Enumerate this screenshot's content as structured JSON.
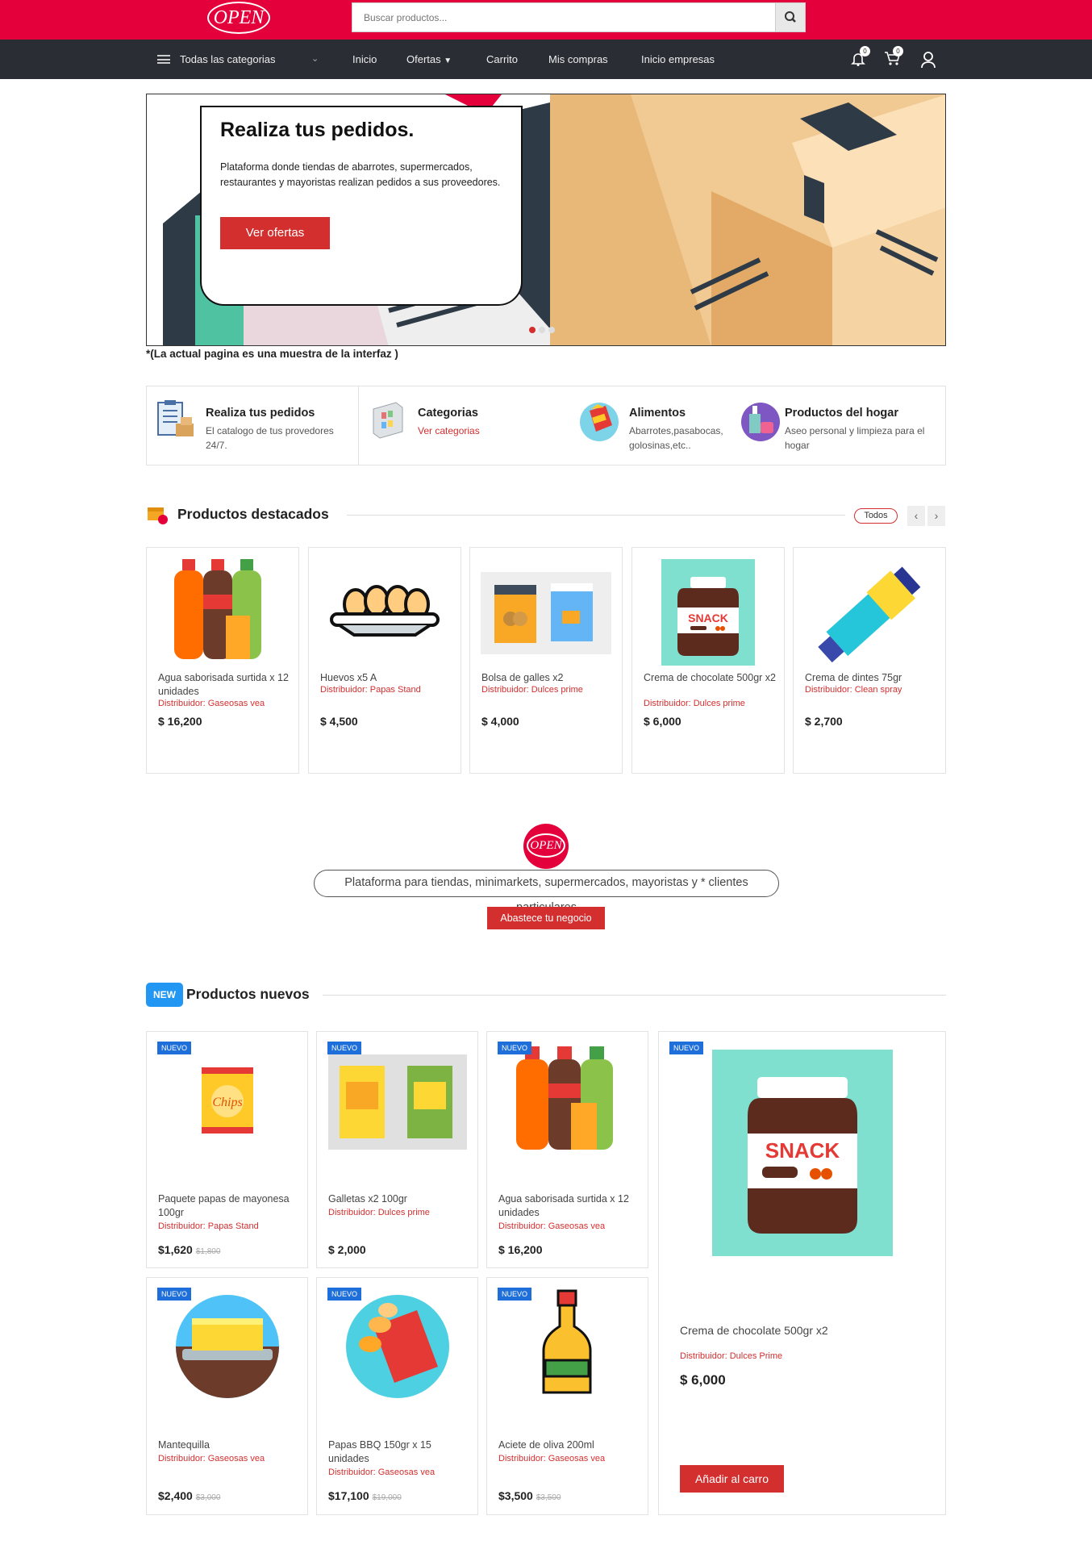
{
  "header": {
    "logo": "OPEN",
    "search_placeholder": "Buscar productos..."
  },
  "nav": {
    "categories": "Todas las categorias",
    "links": [
      "Inicio",
      "Ofertas",
      "Carrito",
      "Mis compras",
      "Inicio empresas"
    ],
    "notif_count": "0",
    "cart_count": "0"
  },
  "hero": {
    "title": "Realiza tus pedidos.",
    "text": "Plataforma donde tiendas de abarrotes, supermercados, restaurantes y mayoristas realizan pedidos a sus proveedores.",
    "button": "Ver ofertas"
  },
  "note": "*(La actual pagina es una muestra de la interfaz )",
  "features": [
    {
      "title": "Realiza tus pedidos",
      "sub": "El catalogo de tus provedores 24/7."
    },
    {
      "title": "Categorias",
      "sub": "Ver categorias"
    },
    {
      "title": "Alimentos",
      "sub": "Abarrotes,pasabocas, golosinas,etc.."
    },
    {
      "title": "Productos del hogar",
      "sub": "Aseo personal y limpieza para el hogar"
    }
  ],
  "featured": {
    "title": "Productos destacados",
    "all": "Todos",
    "products": [
      {
        "name": "Agua saborisada surtida x 12 unidades",
        "dist": "Distribuidor: Gaseosas vea",
        "price": "$ 16,200"
      },
      {
        "name": "Huevos x5 A",
        "dist": "Distribuidor: Papas Stand",
        "price": "$ 4,500"
      },
      {
        "name": "Bolsa de galles x2",
        "dist": "Distribuidor: Dulces prime",
        "price": "$ 4,000"
      },
      {
        "name": "Crema de chocolate 500gr x2",
        "dist": "Distribuidor: Dulces prime",
        "price": "$ 6,000"
      },
      {
        "name": "Crema de dintes 75gr",
        "dist": "Distribuidor: Clean spray",
        "price": "$ 2,700"
      }
    ]
  },
  "promo": {
    "logo": "OPEN",
    "text": "Plataforma para tiendas, minimarkets, supermercados, mayoristas y * clientes particulares",
    "button": "Abastece tu negocio"
  },
  "new_products": {
    "badge": "NEW",
    "title": "Productos nuevos",
    "tag": "NUEVO",
    "products": [
      {
        "name": "Paquete papas de mayonesa 100gr",
        "dist": "Distribuidor: Papas Stand",
        "price": "$1,620",
        "old": "$1,800"
      },
      {
        "name": "Galletas x2 100gr",
        "dist": "Distribuidor: Dulces prime",
        "price": "$ 2,000",
        "old": ""
      },
      {
        "name": "Agua saborisada surtida x 12 unidades",
        "dist": "Distribuidor: Gaseosas vea",
        "price": "$ 16,200",
        "old": ""
      },
      {
        "name": "Mantequilla",
        "dist": "Distribuidor: Gaseosas vea",
        "price": "$2,400",
        "old": "$3,000"
      },
      {
        "name": "Papas BBQ 150gr x 15 unidades",
        "dist": "Distribuidor: Gaseosas vea",
        "price": "$17,100",
        "old": "$19,000"
      },
      {
        "name": "Aciete de oliva 200ml",
        "dist": "Distribuidor: Gaseosas vea",
        "price": "$3,500",
        "old": "$3,500"
      }
    ],
    "big": {
      "name": "Crema de chocolate 500gr x2",
      "dist": "Distribuidor: Dulces Prime",
      "price": "$ 6,000",
      "button": "Añadir al carro"
    }
  },
  "colors": {
    "brand": "#e4003b",
    "nav": "#2b2d35",
    "accent": "#d32f2f",
    "new": "#2196f3"
  }
}
